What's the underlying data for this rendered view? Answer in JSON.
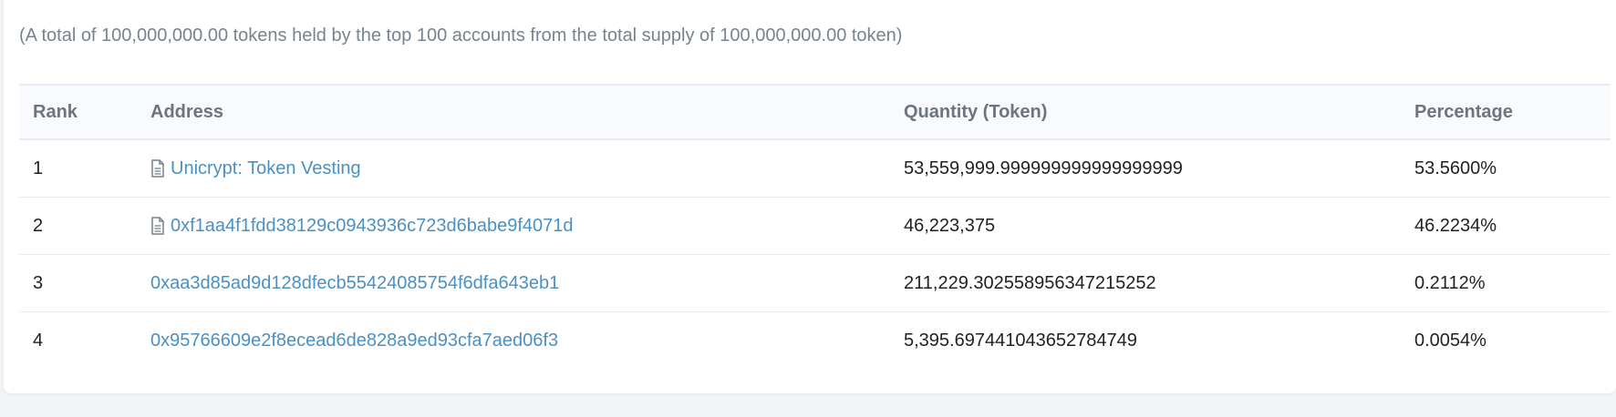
{
  "summary": "(A total of 100,000,000.00 tokens held by the top 100 accounts from the total supply of 100,000,000.00 token)",
  "columns": {
    "rank": "Rank",
    "address": "Address",
    "quantity": "Quantity (Token)",
    "percentage": "Percentage"
  },
  "rows": [
    {
      "rank": "1",
      "address": "Unicrypt: Token Vesting",
      "is_contract": true,
      "quantity": "53,559,999.999999999999999999",
      "percentage": "53.5600%"
    },
    {
      "rank": "2",
      "address": "0xf1aa4f1fdd38129c0943936c723d6babe9f4071d",
      "is_contract": true,
      "quantity": "46,223,375",
      "percentage": "46.2234%"
    },
    {
      "rank": "3",
      "address": "0xaa3d85ad9d128dfecb55424085754f6dfa643eb1",
      "is_contract": false,
      "quantity": "211,229.302558956347215252",
      "percentage": "0.2112%"
    },
    {
      "rank": "4",
      "address": "0x95766609e2f8ecead6de828a9ed93cfa7aed06f3",
      "is_contract": false,
      "quantity": "5,395.697441043652784749",
      "percentage": "0.0054%"
    }
  ],
  "colors": {
    "link": "#4a90c2",
    "header_bg": "#f8fafd",
    "muted_text": "#77838f"
  },
  "icons": {
    "contract": "document-icon"
  }
}
